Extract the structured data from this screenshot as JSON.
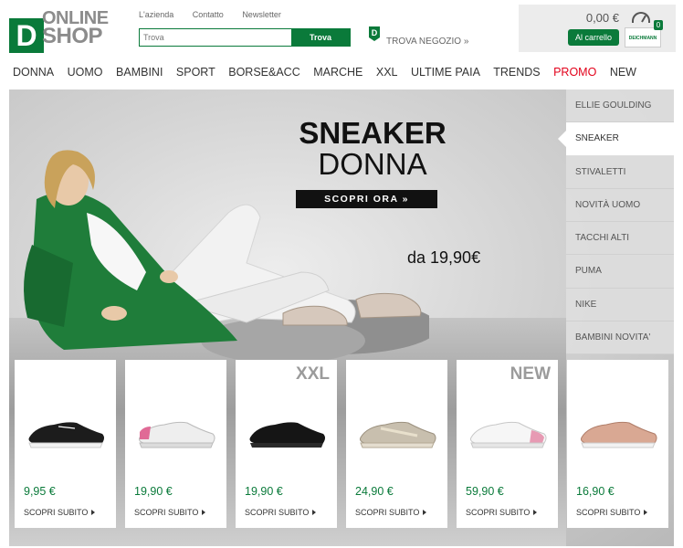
{
  "logo": {
    "mark": "D",
    "line1": "ONLINE",
    "line2": "SHOP"
  },
  "top_links": [
    "L'azienda",
    "Contatto",
    "Newsletter"
  ],
  "search": {
    "placeholder": "Trova",
    "button": "Trova"
  },
  "store_locator": {
    "icon": "store-pin-icon",
    "label": "TROVA NEGOZIO »",
    "mark": "D"
  },
  "cart": {
    "total": "0,00 €",
    "button": "Al carrello",
    "count": "0",
    "bag_text": "DEICHMANN"
  },
  "nav": [
    "DONNA",
    "UOMO",
    "BAMBINI",
    "SPORT",
    "BORSE&ACC",
    "MARCHE",
    "XXL",
    "ULTIME PAIA",
    "TRENDS",
    "PROMO",
    "NEW"
  ],
  "colors": {
    "brand": "#0a7a3a",
    "promo": "#e2001a"
  },
  "hero": {
    "title": "SNEAKER",
    "subtitle": "DONNA",
    "cta": "SCOPRI ORA   »",
    "price": "da 19,90€"
  },
  "side_menu": [
    "ELLIE GOULDING",
    "SNEAKER",
    "STIVALETTI",
    "NOVITÀ UOMO",
    "TACCHI ALTI",
    "PUMA",
    "NIKE",
    "BAMBINI NOVITA'"
  ],
  "side_menu_active": "SNEAKER",
  "products": [
    {
      "price": "9,95 €",
      "cta": "SCOPRI SUBITO",
      "tag": "",
      "color": "black-white"
    },
    {
      "price": "19,90 €",
      "cta": "SCOPRI SUBITO",
      "tag": "",
      "color": "white-pink"
    },
    {
      "price": "19,90 €",
      "cta": "SCOPRI SUBITO",
      "tag": "XXL",
      "color": "black"
    },
    {
      "price": "24,90 €",
      "cta": "SCOPRI SUBITO",
      "tag": "",
      "color": "beige-glitter"
    },
    {
      "price": "59,90 €",
      "cta": "SCOPRI SUBITO",
      "tag": "NEW",
      "color": "white-pink-metal"
    },
    {
      "price": "16,90 €",
      "cta": "SCOPRI SUBITO",
      "tag": "",
      "color": "rose-gold"
    }
  ]
}
